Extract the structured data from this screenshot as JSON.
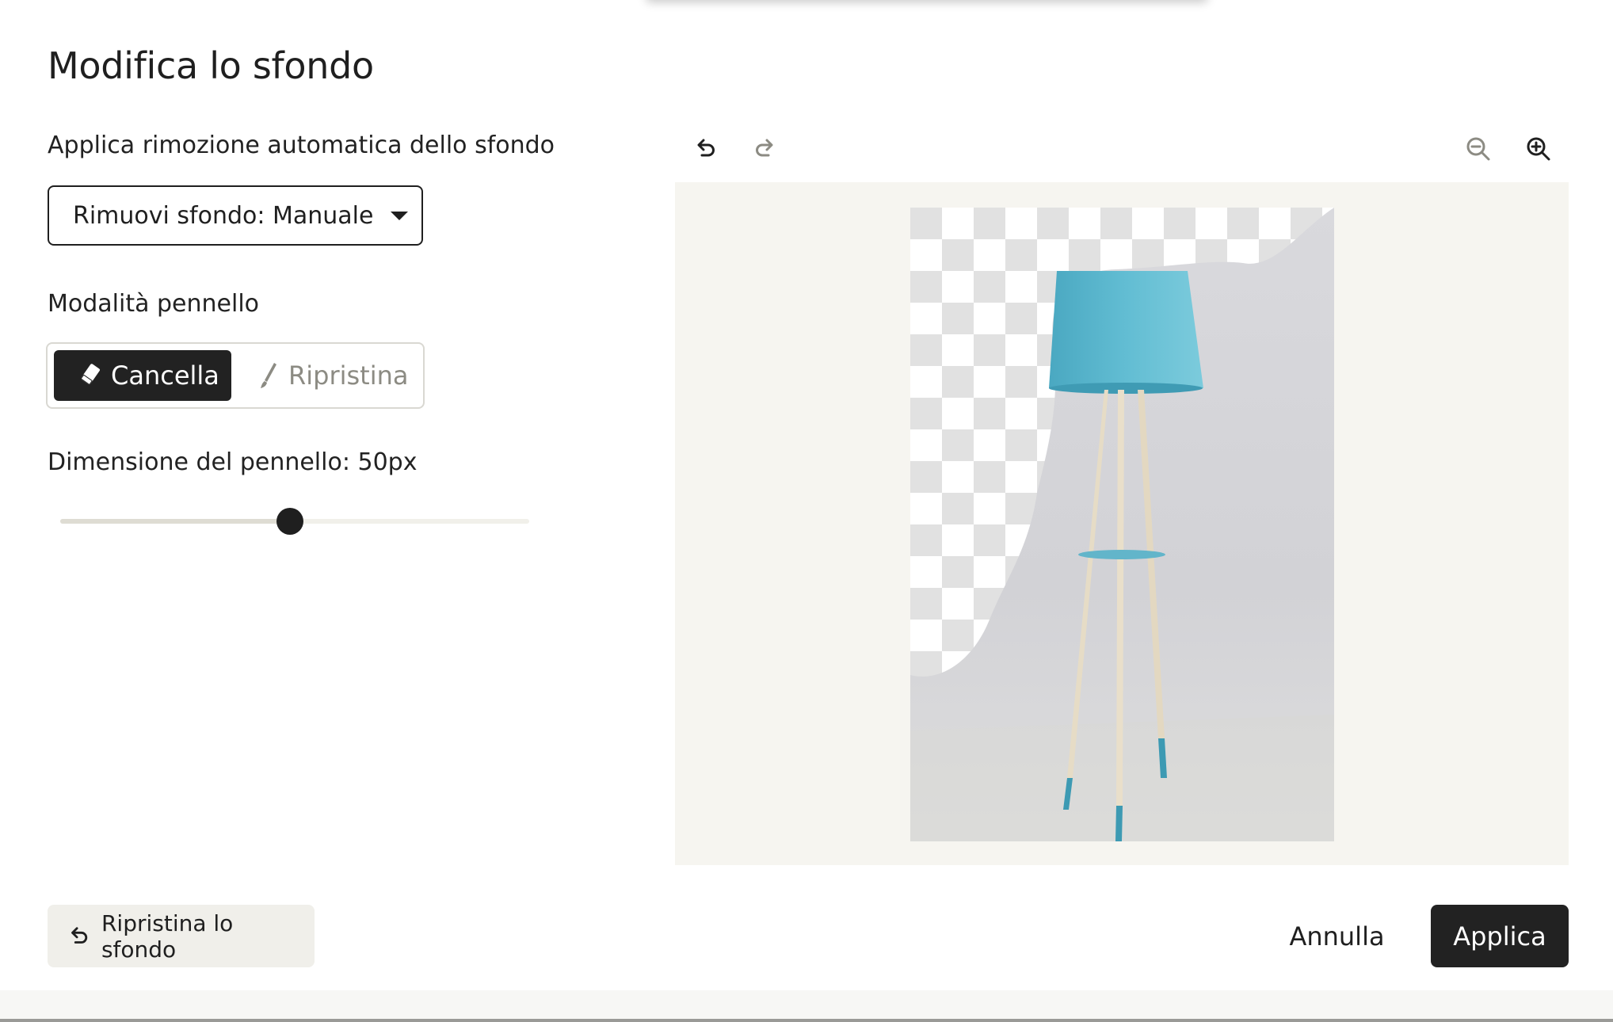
{
  "dialog": {
    "title": "Modifica lo sfondo"
  },
  "auto_removal": {
    "label": "Applica rimozione automatica dello sfondo",
    "dropdown_value": "Rimuovi sfondo: Manuale",
    "dropdown_icon": "caret-down-icon"
  },
  "brush_mode": {
    "label": "Modalità pennello",
    "options": [
      {
        "label": "Cancella",
        "icon": "eraser-icon",
        "selected": true
      },
      {
        "label": "Ripristina",
        "icon": "brush-icon",
        "selected": false
      }
    ]
  },
  "brush_size": {
    "label": "Dimensione del pennello:",
    "value_text": "50px",
    "slider_fraction": 0.49
  },
  "toolbar": {
    "undo_icon": "undo-icon",
    "redo_icon": "redo-icon",
    "zoom_out_icon": "zoom-out-icon",
    "zoom_in_icon": "zoom-in-icon"
  },
  "footer": {
    "reset_label": "Ripristina lo sfondo",
    "reset_icon": "reset-icon",
    "cancel_label": "Annulla",
    "apply_label": "Applica"
  },
  "colors": {
    "primary": "#222222",
    "canvas_bg": "#f6f5f0",
    "muted_text": "#8c8b83",
    "lamp_shade": "#5bb6cc"
  }
}
